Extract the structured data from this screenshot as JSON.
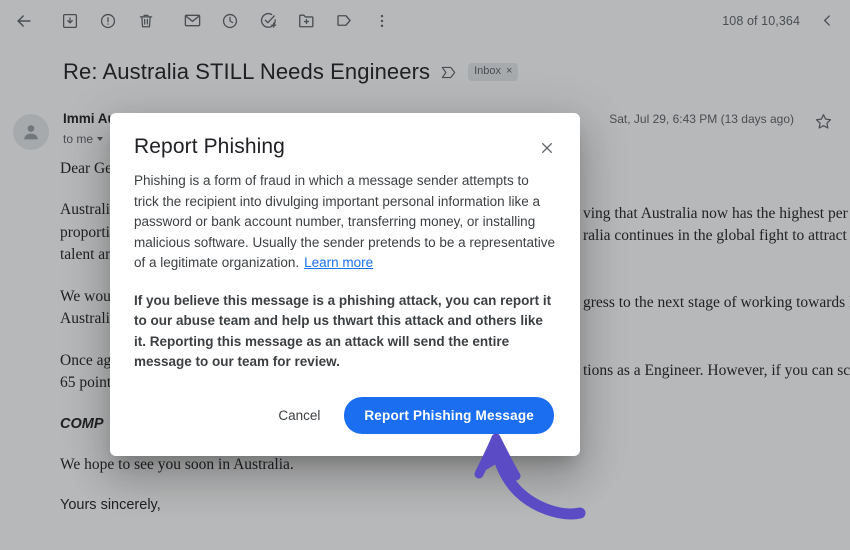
{
  "toolbar": {
    "icons": [
      {
        "name": "back-arrow-icon",
        "label": "Back"
      },
      {
        "name": "archive-icon",
        "label": "Archive"
      },
      {
        "name": "report-spam-icon",
        "label": "Report spam"
      },
      {
        "name": "delete-trash-icon",
        "label": "Delete"
      },
      {
        "name": "mark-unread-envelope-icon",
        "label": "Mark as unread"
      },
      {
        "name": "snooze-clock-icon",
        "label": "Snooze"
      },
      {
        "name": "add-to-tasks-icon",
        "label": "Add to Tasks"
      },
      {
        "name": "move-to-folder-icon",
        "label": "Move to"
      },
      {
        "name": "label-tag-icon",
        "label": "Labels"
      },
      {
        "name": "more-options-icon",
        "label": "More"
      }
    ],
    "counter": "108 of 10,364",
    "prev_icon": "chevron-left-icon"
  },
  "thread": {
    "subject": "Re: Australia STILL Needs Engineers",
    "important_marker_icon": "important-marker-icon",
    "inbox_chip_label": "Inbox",
    "inbox_chip_remove": "×",
    "sender_name": "Immi Au",
    "recipient": "to me",
    "date": "Sat, Jul 29, 6:43 PM (13 days ago)",
    "star_icon": "star-outline-icon",
    "avatar_icon": "person-avatar-icon"
  },
  "message_body": {
    "lines": [
      {
        "text": "Dear Ge",
        "style": "serif"
      },
      {
        "text": "Australi",
        "style": "serif"
      },
      {
        "text": "proporti",
        "style": "serif"
      },
      {
        "text": "talent an",
        "style": "serif"
      },
      {
        "text": "We wou",
        "style": "serif"
      },
      {
        "text": "Australia",
        "style": "serif"
      },
      {
        "text": "Once ag",
        "style": "serif"
      },
      {
        "text": "65 point",
        "style": "serif"
      },
      {
        "text": "COMP",
        "style": "italic"
      },
      {
        "text": "We hope to see you soon in Australia.",
        "style": "serif"
      },
      {
        "text": "Yours sincerely,",
        "style": "sans"
      }
    ],
    "right_fragments": [
      "ving that Australia now has the highest per cap",
      "ralia continues in the global fight to attract int",
      "gress to the next stage of working towards P.R",
      "tions as a Engineer. However, if you can scor"
    ]
  },
  "dialog": {
    "title": "Report Phishing",
    "close_icon": "close-x-icon",
    "paragraph_1": "Phishing is a form of fraud in which a message sender attempts to trick the recipient into divulging important personal information like a password or bank account number, transferring money, or installing malicious software. Usually the sender pretends to be a representative of a legitimate organization.",
    "learn_more_label": "Learn more",
    "paragraph_2": "If you believe this message is a phishing attack, you can report it to our abuse team and help us thwart this attack and others like it. Reporting this message as an attack will send the entire message to our team for review.",
    "cancel_label": "Cancel",
    "confirm_label": "Report Phishing Message"
  },
  "annotation": {
    "arrow_icon": "curved-arrow-annotation",
    "color": "#5b4bc4"
  },
  "colors": {
    "accent_blue": "#1b6ef0",
    "link_blue": "#1a73e8",
    "text_primary": "#202124",
    "text_secondary": "#5f6368",
    "annotation_purple": "#5b4bc4"
  }
}
